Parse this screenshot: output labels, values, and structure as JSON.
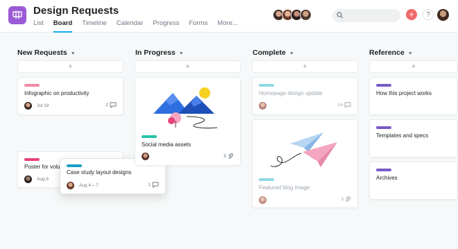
{
  "header": {
    "title": "Design Requests",
    "project_icon": "board-icon",
    "tabs": [
      "List",
      "Board",
      "Timeline",
      "Calendar",
      "Progress",
      "Forms",
      "More..."
    ],
    "active_tab": "Board",
    "colors": {
      "accent": "#14aaf5",
      "project_icon": "#9b5bd6",
      "add_button": "#f06a6a"
    }
  },
  "board": {
    "columns": [
      {
        "title": "New Requests"
      },
      {
        "title": "In Progress"
      },
      {
        "title": "Complete"
      },
      {
        "title": "Reference"
      }
    ],
    "add_label": "+",
    "cards": {
      "infographic": {
        "title": "Infographic on productivity",
        "date": "Jul 19",
        "comments": "2",
        "tag_color": "#f18aa6"
      },
      "poster": {
        "title": "Poster for volu",
        "date": "Aug 6",
        "tag_color": "#e8437a"
      },
      "case_study": {
        "title": "Case study layout designs",
        "date": "Aug 4 – 7",
        "comments": "1",
        "tag_color": "#1a9ec9"
      },
      "social": {
        "title": "Social media assets",
        "attachments": "5",
        "tag_color": "#27c3a7"
      },
      "homepage": {
        "title": "Homepage design update",
        "comments": "14",
        "tag_color": "#8fd9e4"
      },
      "blog": {
        "title": "Featured blog image",
        "attachments": "3",
        "tag_color": "#8fd9e4"
      },
      "how_works": {
        "title": "How this project works",
        "tag_color": "#7a5bc7"
      },
      "templates": {
        "title": "Templates and specs",
        "tag_color": "#7a5bc7"
      },
      "archives": {
        "title": "Archives",
        "tag_color": "#7a5bc7"
      }
    }
  }
}
